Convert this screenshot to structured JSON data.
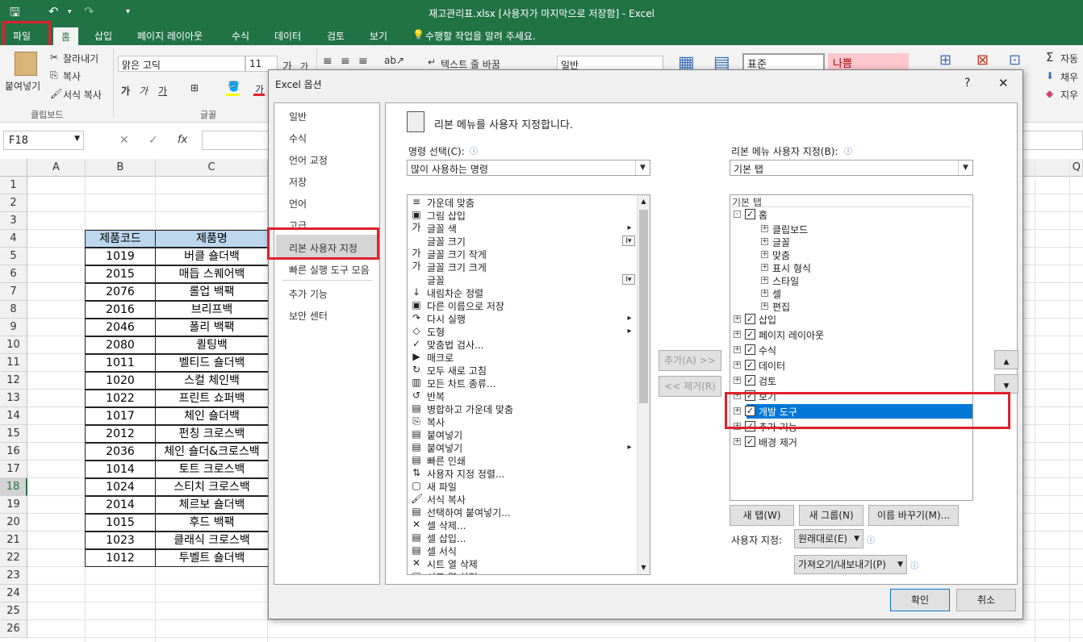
{
  "window": {
    "title": "재고관리표.xlsx [사용자가 마지막으로 저장함] - Excel"
  },
  "ribbon_tabs": [
    "파일",
    "홈",
    "삽입",
    "페이지 레이아웃",
    "수식",
    "데이터",
    "검토",
    "보기"
  ],
  "tell_me": "수행할 작업을 알려 주세요.",
  "ribbon": {
    "paste": "붙여넣기",
    "cut": "잘라내기",
    "copy": "복사",
    "format_painter": "서식 복사",
    "clipboard_group": "클립보드",
    "font_name": "맑은 고딕",
    "font_size": "11",
    "font_group": "글꼴",
    "wrap_text": "텍스트 줄 바꿈",
    "number_format": "일반",
    "style_normal": "표준",
    "style_bad": "나쁨",
    "autosum": "자동",
    "fill": "채우",
    "clear": "지우"
  },
  "formula_bar": {
    "name_box": "F18",
    "fx": "fx"
  },
  "sheet": {
    "columns": [
      "A",
      "B",
      "C"
    ],
    "right_column": "Q",
    "rows": [
      "1",
      "2",
      "3",
      "4",
      "5",
      "6",
      "7",
      "8",
      "9",
      "10",
      "11",
      "12",
      "13",
      "14",
      "15",
      "16",
      "17",
      "18",
      "19",
      "20",
      "21",
      "22",
      "23",
      "24",
      "25",
      "26"
    ],
    "selected_row": "18",
    "table_header": [
      "제품코드",
      "제품명"
    ],
    "table_rows": [
      [
        "1019",
        "버클 숄더백"
      ],
      [
        "2015",
        "매듭 스퀘어백"
      ],
      [
        "2076",
        "롤업 백팩"
      ],
      [
        "2016",
        "브리프백"
      ],
      [
        "2046",
        "폴리 백팩"
      ],
      [
        "2080",
        "퀼팅백"
      ],
      [
        "1011",
        "벨티드 숄더백"
      ],
      [
        "1020",
        "스컬 체인백"
      ],
      [
        "1022",
        "프린트 쇼퍼백"
      ],
      [
        "1017",
        "체인 숄더백"
      ],
      [
        "2012",
        "펀칭 크로스백"
      ],
      [
        "2036",
        "체인 숄더&크로스백"
      ],
      [
        "1014",
        "토트 크로스백"
      ],
      [
        "1024",
        "스티치 크로스백"
      ],
      [
        "2014",
        "체르보 숄더백"
      ],
      [
        "1015",
        "후드 백팩"
      ],
      [
        "1023",
        "클래식 크로스백"
      ],
      [
        "1012",
        "투벨트 숄더백"
      ]
    ]
  },
  "dialog": {
    "title": "Excel 옵션",
    "help": "?",
    "close": "✕",
    "nav": [
      "일반",
      "수식",
      "언어 교정",
      "저장",
      "언어",
      "고급",
      "리본 사용자 지정",
      "빠른 실행 도구 모음",
      "추가 기능",
      "보안 센터"
    ],
    "selected_nav": "리본 사용자 지정",
    "heading": "리본 메뉴를 사용자 지정합니다.",
    "choose_label": "명령 선택(C):",
    "choose_value": "많이 사용하는 명령",
    "customize_label": "리본 메뉴 사용자 지정(B):",
    "customize_value": "기본 탭",
    "commands": [
      "가운데 맞춤",
      "그림 삽입",
      "글꼴 색",
      "글꼴 크기",
      "글꼴 크기 작게",
      "글꼴 크기 크게",
      "글꼴",
      "내림차순 정렬",
      "다른 이름으로 저장",
      "다시 실행",
      "도형",
      "맞춤법 검사...",
      "매크로",
      "모두 새로 고침",
      "모든 차트 종류...",
      "반복",
      "병합하고 가운데 맞춤",
      "복사",
      "붙여넣기",
      "붙여넣기",
      "빠른 인쇄",
      "사용자 지정 정렬...",
      "새 파일",
      "서식 복사",
      "선택하여 붙여넣기...",
      "셀 삭제...",
      "셀 삽입...",
      "셀 서식",
      "시트 열 삭제",
      "시트 열 삽입"
    ],
    "add_button": "추가(A) >>",
    "remove_button": "<< 제거(R)",
    "tree_header": "기본 탭",
    "tree": {
      "home": "홈",
      "home_groups": [
        "클립보드",
        "글꼴",
        "맞춤",
        "표시 형식",
        "스타일",
        "셀",
        "편집"
      ],
      "tabs": [
        "삽입",
        "페이지 레이아웃",
        "수식",
        "데이터",
        "검토",
        "보기",
        "개발 도구",
        "추가 기능",
        "배경 제거"
      ],
      "selected": "개발 도구"
    },
    "new_tab": "새 탭(W)",
    "new_group": "새 그룹(N)",
    "rename": "이름 바꾸기(M)...",
    "customizations_label": "사용자 지정:",
    "reset": "원래대로(E)",
    "import_export": "가져오기/내보내기(P)",
    "ok": "확인",
    "cancel": "취소"
  },
  "colors": {
    "excel_green": "#217346",
    "highlight_red": "#e0202c",
    "selection_blue": "#0078d7",
    "header_fill": "#bdd7ee"
  }
}
